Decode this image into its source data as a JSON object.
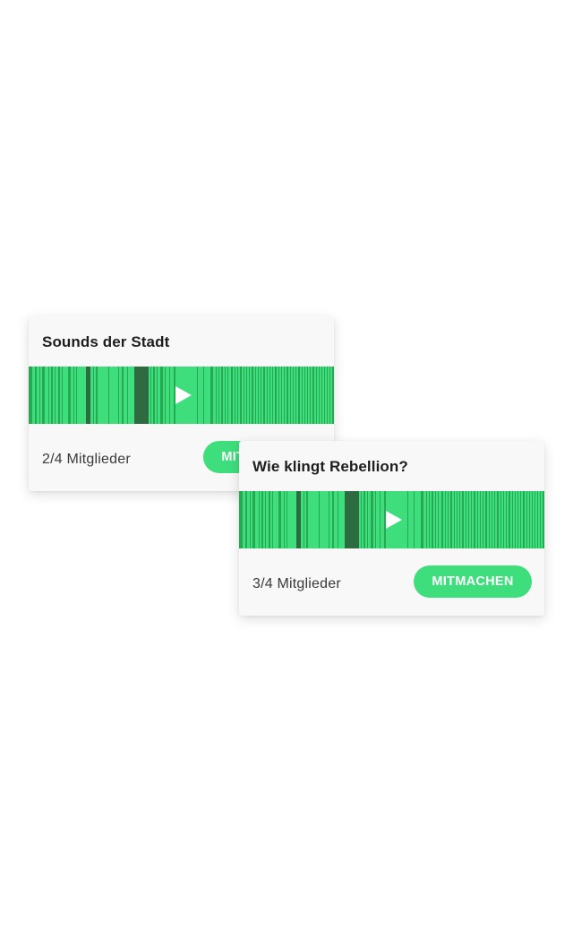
{
  "colors": {
    "accent": "#3ede7d",
    "wave_light": "#3ede7d",
    "wave_mid": "#27a954",
    "wave_dark": "#2f6b41",
    "card_bg": "#f8f8f8"
  },
  "cards": [
    {
      "title": "Sounds der Stadt",
      "members": "2/4 Mitglieder",
      "button_label": "MITMACHEN",
      "play_icon": "play-icon"
    },
    {
      "title": "Wie klingt Rebellion?",
      "members": "3/4 Mitglieder",
      "button_label": "MITMACHEN",
      "play_icon": "play-icon"
    }
  ]
}
